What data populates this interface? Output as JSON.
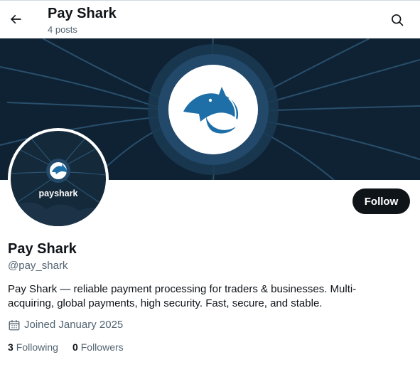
{
  "header": {
    "title": "Pay Shark",
    "posts_count": "4 posts"
  },
  "avatar": {
    "logo_text": "payshark"
  },
  "profile": {
    "follow_label": "Follow",
    "name": "Pay Shark",
    "handle": "@pay_shark",
    "bio": "Pay Shark — reliable payment processing for traders & businesses. Multi-acquiring, global payments, high security. Fast, secure, and stable.",
    "joined": "Joined January 2025",
    "following_count": "3",
    "following_label": "Following",
    "followers_count": "0",
    "followers_label": "Followers"
  },
  "colors": {
    "banner_bg": "#0f2233",
    "brand_blue": "#1e6fa8",
    "follow_bg": "#0f1419",
    "secondary_text": "#536471"
  },
  "icons": [
    "arrow-left-icon",
    "search-icon",
    "shark-logo-icon",
    "calendar-icon"
  ]
}
